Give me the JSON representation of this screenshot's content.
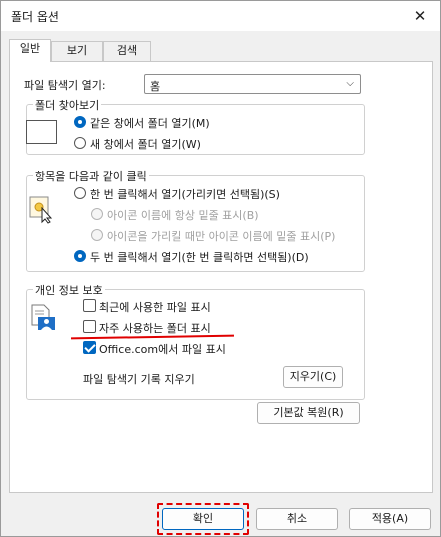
{
  "window": {
    "title": "폴더 옵션",
    "close_glyph": "✕"
  },
  "tabs": [
    {
      "label": "일반"
    },
    {
      "label": "보기"
    },
    {
      "label": "검색"
    }
  ],
  "explorer_open": {
    "label": "파일 탐색기 열기:",
    "value": "홈",
    "arrow": "⌵"
  },
  "browse_folders": {
    "title": "폴더 찾아보기",
    "options": [
      {
        "label": "같은 창에서 폴더 열기(M)",
        "checked": true
      },
      {
        "label": "새 창에서 폴더 열기(W)",
        "checked": false
      }
    ]
  },
  "click_items": {
    "title": "항목을 다음과 같이 클릭",
    "options": [
      {
        "label": "한 번 클릭해서 열기(가리키면 선택됨)(S)",
        "checked": false
      },
      {
        "label": "아이콘 이름에 항상 밑줄 표시(B)",
        "checked": false,
        "disabled": true
      },
      {
        "label": "아이콘을 가리킬 때만 아이콘 이름에 밑줄 표시(P)",
        "checked": false,
        "disabled": true
      },
      {
        "label": "두 번 클릭해서 열기(한 번 클릭하면 선택됨)(D)",
        "checked": true
      }
    ]
  },
  "privacy": {
    "title": "개인 정보 보호",
    "checkboxes": [
      {
        "label": "최근에 사용한 파일 표시",
        "checked": false
      },
      {
        "label": "자주 사용하는 폴더 표시",
        "checked": false
      },
      {
        "label": "Office.com에서 파일 표시",
        "checked": true
      }
    ],
    "clear_label": "파일 탐색기 기록 지우기",
    "clear_button": "지우기(C)"
  },
  "restore_button": "기본값 복원(R)",
  "footer": {
    "ok": "확인",
    "cancel": "취소",
    "apply": "적용(A)"
  },
  "colors": {
    "accent": "#0067c0",
    "annotation": "#e00000"
  }
}
